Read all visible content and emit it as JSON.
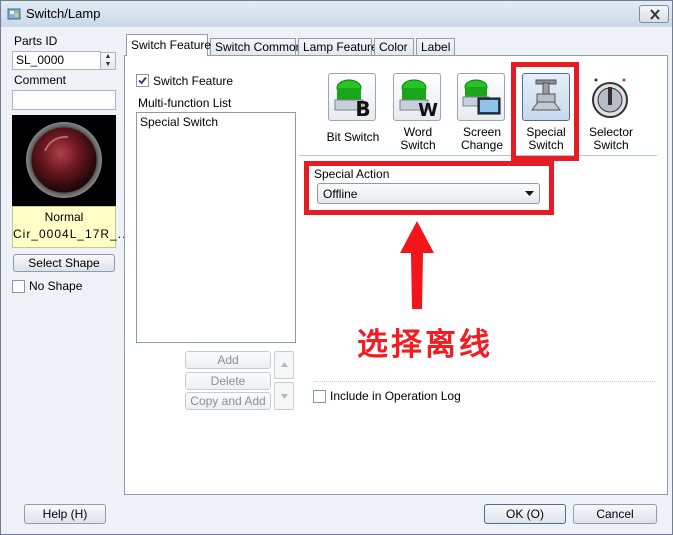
{
  "window": {
    "title": "Switch/Lamp"
  },
  "left": {
    "parts_id_label": "Parts ID",
    "parts_id_value": "SL_0000",
    "comment_label": "Comment",
    "comment_value": "",
    "preview_state": "Normal",
    "preview_shape": "Cir_0004L_17R_...",
    "select_shape_label": "Select Shape",
    "no_shape_label": "No Shape",
    "no_shape_checked": false
  },
  "tabs": [
    {
      "label": "Switch Feature",
      "active": true
    },
    {
      "label": "Switch Common",
      "active": false
    },
    {
      "label": "Lamp Feature",
      "active": false
    },
    {
      "label": "Color",
      "active": false
    },
    {
      "label": "Label",
      "active": false
    }
  ],
  "feature": {
    "switch_feature_label": "Switch Feature",
    "switch_feature_checked": true,
    "multi_function_list_label": "Multi-function List",
    "list_items": [
      "Special Switch"
    ],
    "add_label": "Add",
    "delete_label": "Delete",
    "copy_add_label": "Copy and Add",
    "include_log_label": "Include in Operation Log",
    "include_log_checked": false
  },
  "switch_types": [
    {
      "name": "bit-switch",
      "line1": "Bit Switch",
      "line2": "",
      "icon": "bit-switch-icon"
    },
    {
      "name": "word-switch",
      "line1": "Word",
      "line2": "Switch",
      "icon": "word-switch-icon"
    },
    {
      "name": "screen-change",
      "line1": "Screen",
      "line2": "Change",
      "icon": "screen-change-icon"
    },
    {
      "name": "special-switch",
      "line1": "Special",
      "line2": "Switch",
      "icon": "special-switch-icon",
      "selected": true
    },
    {
      "name": "selector-switch",
      "line1": "Selector",
      "line2": "Switch",
      "icon": "selector-switch-icon"
    }
  ],
  "special_action": {
    "label": "Special Action",
    "value": "Offline"
  },
  "annotation": {
    "text": "选择离线",
    "color": "#e51c23"
  },
  "footer": {
    "help_label": "Help (H)",
    "ok_label": "OK (O)",
    "cancel_label": "Cancel"
  }
}
